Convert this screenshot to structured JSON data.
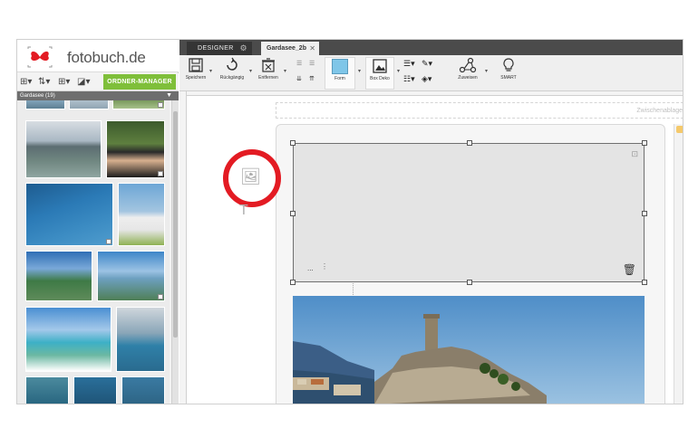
{
  "brand": {
    "name": "fotobuch",
    "tld": ".de",
    "accent_color": "#e31b23"
  },
  "left_panel": {
    "ordner_button": "ORDNER-MANAGER",
    "album_title": "Gardasee (19)"
  },
  "tabs": [
    {
      "label": "DESIGNER"
    },
    {
      "label": "Gardasee_2b"
    }
  ],
  "toolbar": {
    "speichern": "Speichern",
    "rueckgaengig": "Rückgängig",
    "entfernen": "Entfernen",
    "form": "Form",
    "box_deko": "Box Deko",
    "zuweisen": "Zuweisen",
    "smart": "SMART"
  },
  "canvas": {
    "zwischenablage": "Zwischenablage",
    "frame_dots": "..."
  },
  "colors": {
    "toolbar_green": "#7fbf3a",
    "highlight_ring": "#e31b23",
    "form_blue": "#7fc6e8"
  }
}
